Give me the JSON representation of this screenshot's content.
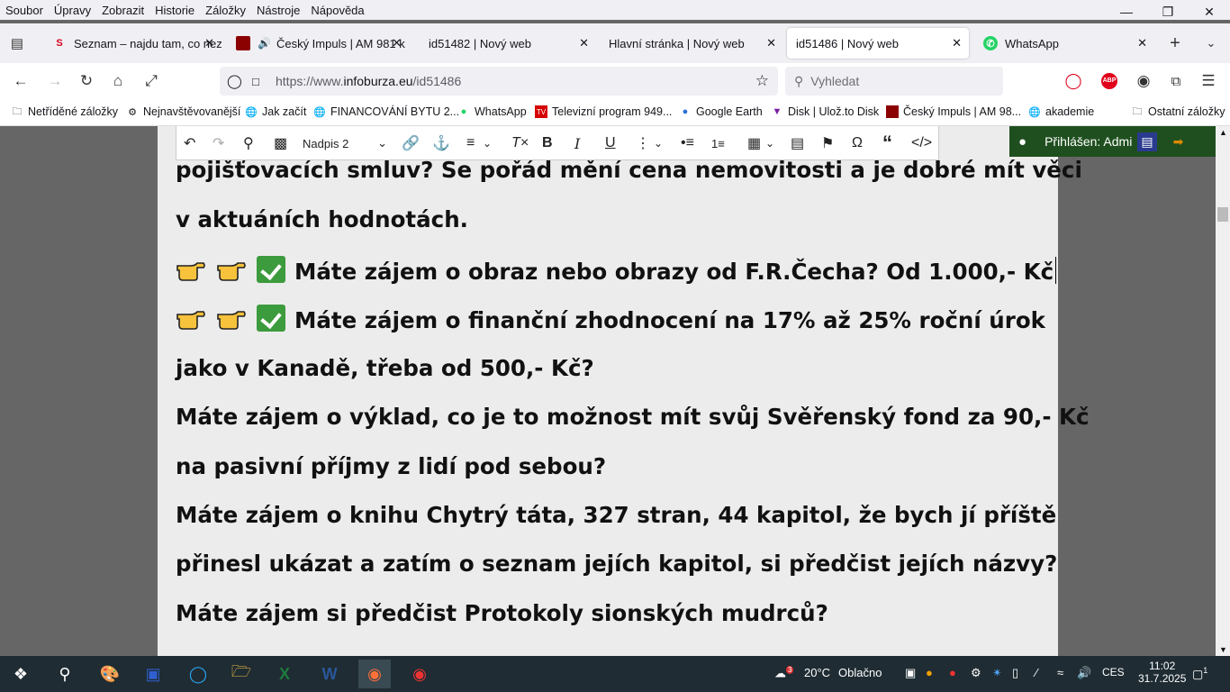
{
  "menu": [
    "Soubor",
    "Úpravy",
    "Zobrazit",
    "Historie",
    "Záložky",
    "Nástroje",
    "Nápověda"
  ],
  "tabs": [
    {
      "title": "Seznam – najdu tam, co nezn",
      "fav": "S",
      "favcolor": "#d6001c"
    },
    {
      "title": "Český Impuls | AM 981 k",
      "fav": "",
      "favcolor": "#8b0000"
    },
    {
      "title": "id51482 | Nový web",
      "fav": "",
      "favcolor": ""
    },
    {
      "title": "Hlavní stránka | Nový web",
      "fav": "",
      "favcolor": ""
    },
    {
      "title": "id51486 | Nový web",
      "fav": "",
      "favcolor": ""
    },
    {
      "title": "WhatsApp",
      "fav": "✆",
      "favcolor": "#25d366"
    }
  ],
  "url": {
    "prefix": "https://www.",
    "host": "infoburza.eu",
    "path": "/id51486"
  },
  "search_placeholder": "Vyhledat",
  "bookmarks": [
    "Netříděné záložky",
    "Nejnavštěvovanější",
    "Jak začít",
    "FINANCOVÁNÍ BYTU 2...",
    "WhatsApp",
    "Televizní program 949...",
    "Google Earth",
    "Disk | Ulož.to Disk",
    "Český Impuls | AM 98...",
    "akademie",
    "Ostatní záložky"
  ],
  "editor": {
    "heading_select": "Nadpis 2"
  },
  "admin": {
    "label": "Přihlášen: Admi"
  },
  "content": {
    "lines": [
      "pojišťovacích smluv? Se pořád mění cena nemovitosti a je dobré mít věci",
      "v aktuáních hodnotách.",
      "Máte zájem o obraz nebo obrazy od F.R.Čecha? Od 1.000,- Kč",
      "Máte zájem o finanční zhodnocení na 17% až 25% roční úrok",
      "jako v Kanadě, třeba od 500,- Kč?",
      "Máte zájem o výklad, co je to možnost mít svůj Svěřenský fond za 90,- Kč",
      "na pasivní příjmy z lidí pod sebou?",
      "Máte zájem o knihu Chytrý táta, 327 stran, 44  kapitol, že bych jí příště",
      "přinesl ukázat a zatím o seznam jejích kapitol, si předčist jejích názvy?",
      "Máte zájem si předčist Protokoly sionských mudrců?"
    ]
  },
  "taskbar": {
    "weather_temp": "20°C",
    "weather_text": "Oblačno",
    "weather_badge": "3",
    "lang": "CES",
    "time": "11:02",
    "date": "31.7.2025",
    "notif": "1"
  }
}
